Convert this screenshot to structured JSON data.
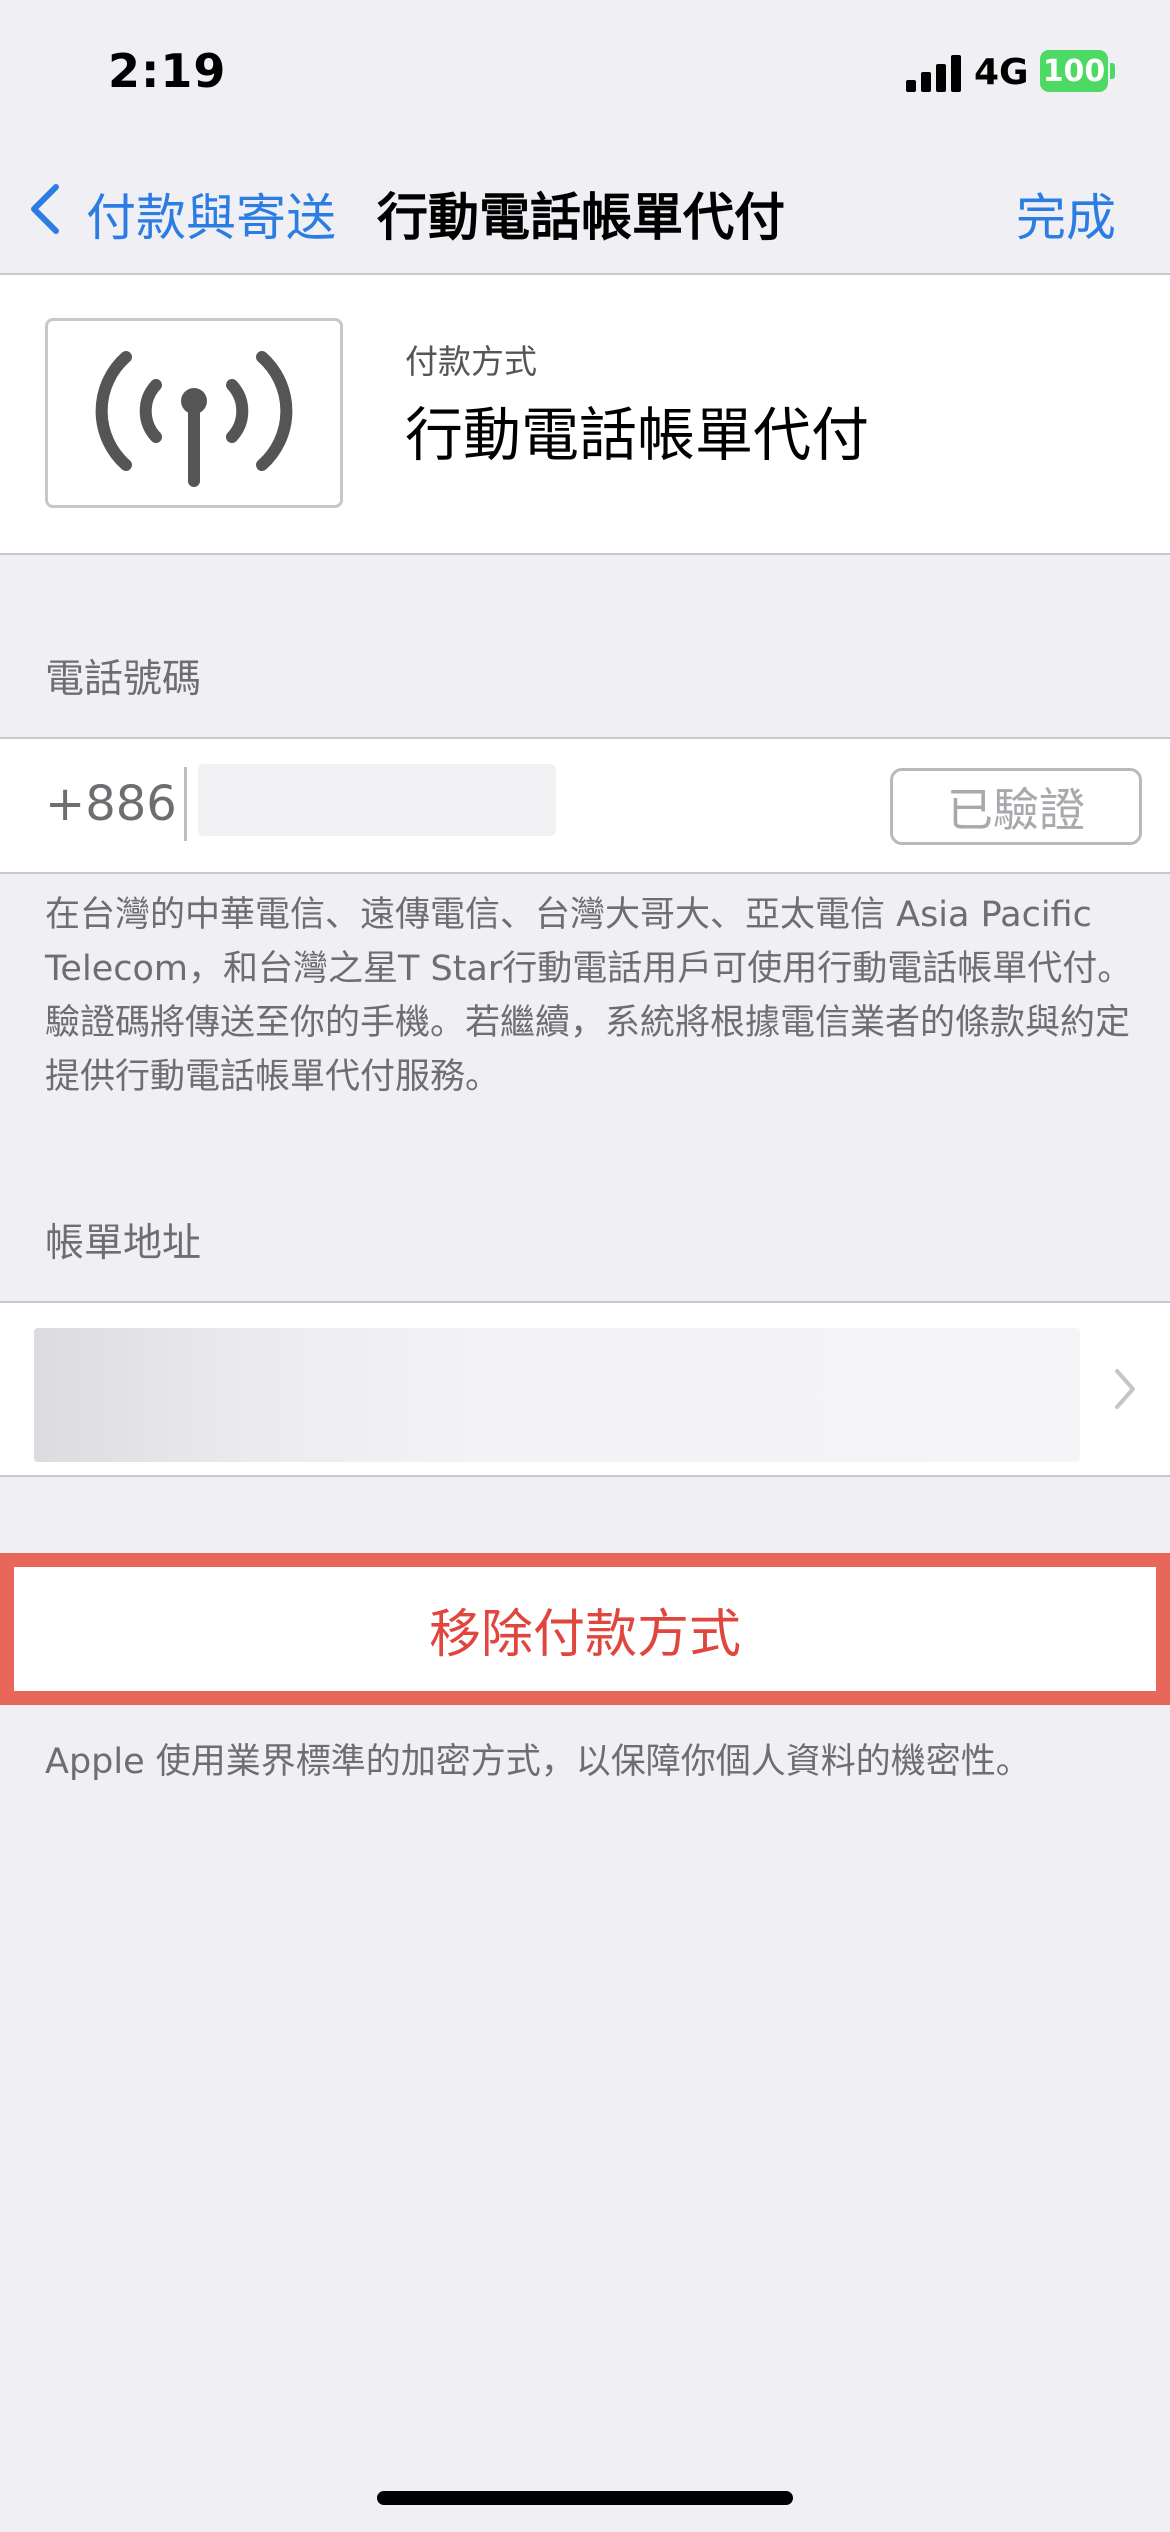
{
  "status_bar": {
    "time": "2:19",
    "network": "4G",
    "battery": "100",
    "battery_color": "#4cd964"
  },
  "nav": {
    "back_label": "付款與寄送",
    "title": "行動電話帳單代付",
    "done_label": "完成",
    "accent_color": "#2b7de3"
  },
  "payment": {
    "icon": "antenna-signal-icon",
    "subtitle": "付款方式",
    "method": "行動電話帳單代付"
  },
  "phone": {
    "section_label": "電話號碼",
    "country_code": "+886",
    "verified_label": "已驗證"
  },
  "note": "在台灣的中華電信、遠傳電信、台灣大哥大、亞太電信 Asia Pacific Telecom，和台灣之星T Star行動電話用戶可使用行動電話帳單代付。驗證碼將傳送至你的手機。若繼續，系統將根據電信業者的條款與約定提供行動電話帳單代付服務。",
  "billing": {
    "section_label": "帳單地址"
  },
  "remove": {
    "label": "移除付款方式",
    "color": "#e0463e"
  },
  "footer": "Apple 使用業界標準的加密方式，以保障你個人資料的機密性。"
}
